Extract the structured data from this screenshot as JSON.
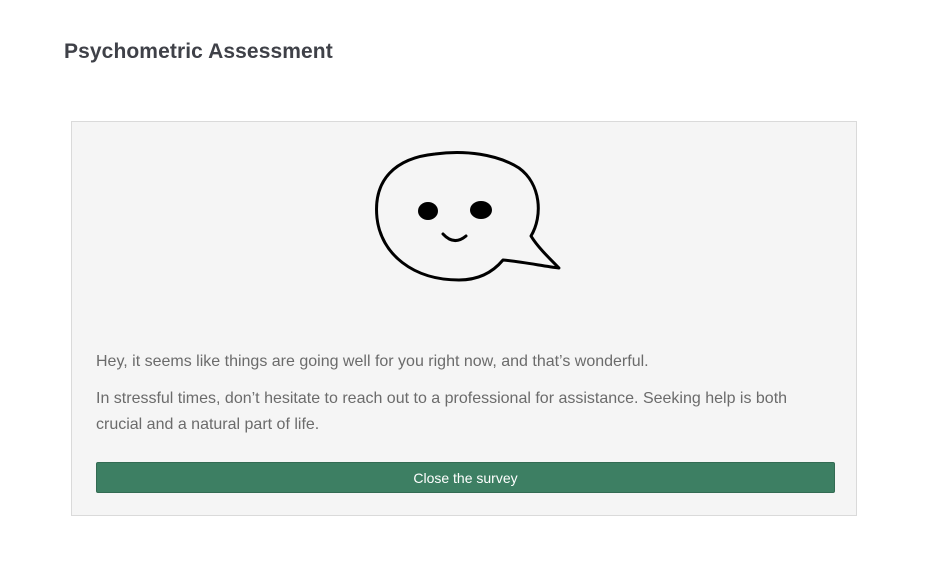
{
  "header": {
    "title": "Psychometric Assessment"
  },
  "card": {
    "illustration_icon": "smiling-speech-bubble-icon",
    "message_primary": "Hey, it seems like things are going well for you right now, and that’s wonderful.",
    "message_secondary": "In stressful times, don’t hesitate to reach out to a professional for assistance. Seeking help is both crucial and a natural part of life.",
    "close_button_label": "Close the survey"
  },
  "colors": {
    "button_background": "#3d7f63",
    "card_background": "#f5f5f5",
    "title_text": "#3f4148",
    "body_text": "#6b6b6b"
  }
}
